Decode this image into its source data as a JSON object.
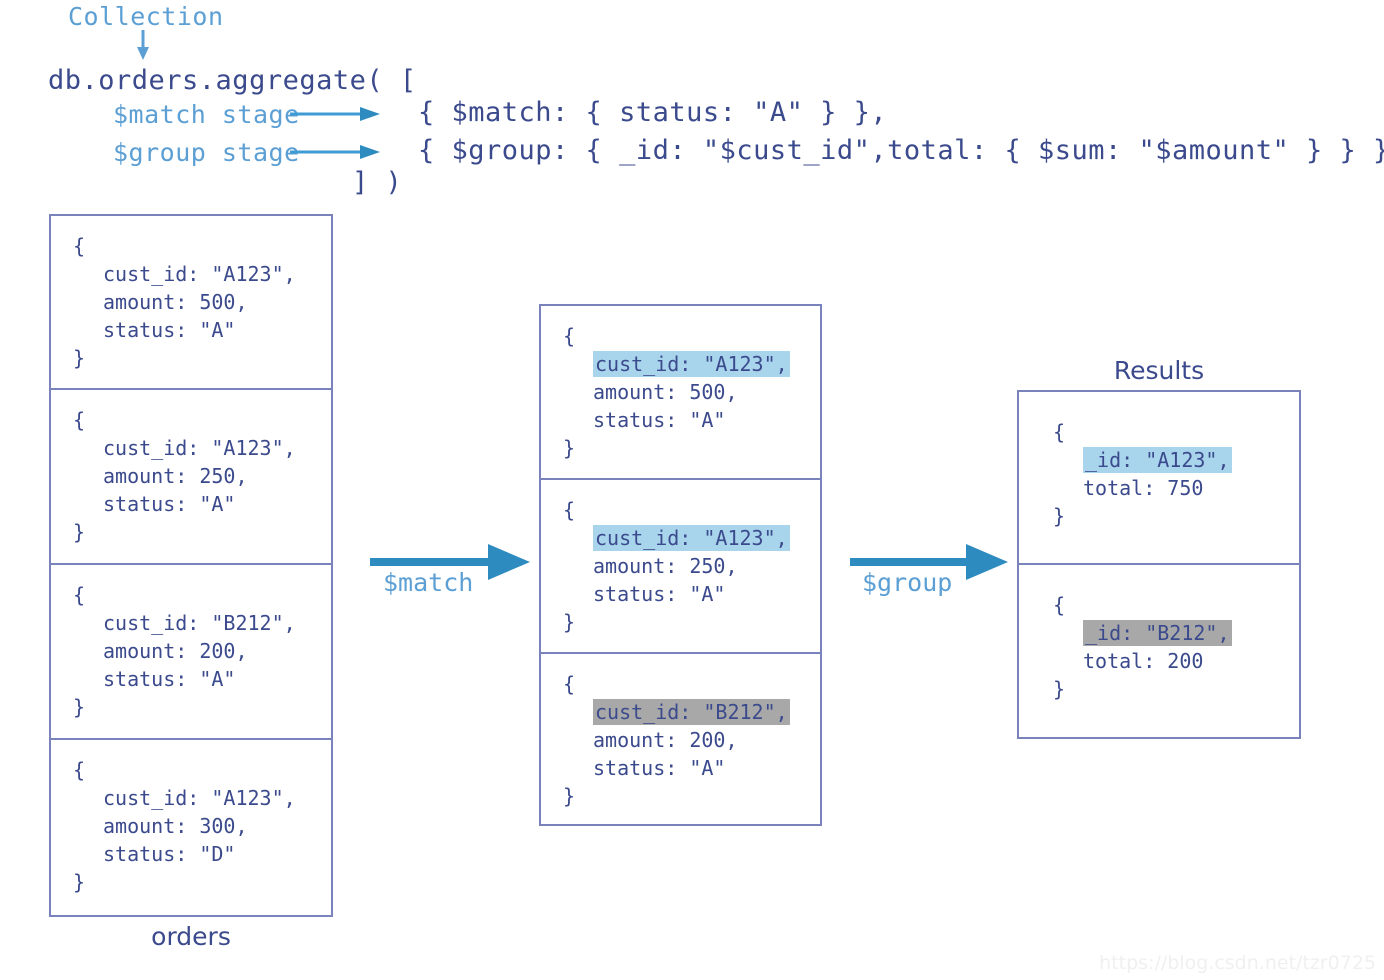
{
  "header": {
    "collection_label": "Collection",
    "aggregate_call": "db.orders.aggregate( [",
    "match_stage_label": "$match stage",
    "group_stage_label": "$group stage",
    "match_stage_code": "{ $match: { status: \"A\" } },",
    "group_stage_code": "{ $group: { _id: \"$cust_id\",total: { $sum: \"$amount\" } } }",
    "close_call": "] )"
  },
  "collection_box": {
    "caption": "orders",
    "documents": [
      {
        "open": "{",
        "lines": [
          "cust_id: \"A123\",",
          "amount: 500,",
          "status: \"A\""
        ],
        "close": "}"
      },
      {
        "open": "{",
        "lines": [
          "cust_id: \"A123\",",
          "amount: 250,",
          "status: \"A\""
        ],
        "close": "}"
      },
      {
        "open": "{",
        "lines": [
          "cust_id: \"B212\",",
          "amount: 200,",
          "status: \"A\""
        ],
        "close": "}"
      },
      {
        "open": "{",
        "lines": [
          "cust_id: \"A123\",",
          "amount: 300,",
          "status: \"D\""
        ],
        "close": "}"
      }
    ]
  },
  "match_arrow": {
    "label": "$match"
  },
  "group_arrow": {
    "label": "$group"
  },
  "matched_box": {
    "documents": [
      {
        "open": "{",
        "highlight": "cust_id: \"A123\",",
        "highlight_color": "blue",
        "lines": [
          "amount: 500,",
          "status: \"A\""
        ],
        "close": "}"
      },
      {
        "open": "{",
        "highlight": "cust_id: \"A123\",",
        "highlight_color": "blue",
        "lines": [
          "amount: 250,",
          "status: \"A\""
        ],
        "close": "}"
      },
      {
        "open": "{",
        "highlight": "cust_id: \"B212\",",
        "highlight_color": "gray",
        "lines": [
          "amount: 200,",
          "status: \"A\""
        ],
        "close": "}"
      }
    ]
  },
  "results_box": {
    "caption": "Results",
    "documents": [
      {
        "open": "{",
        "highlight": "_id: \"A123\",",
        "highlight_color": "blue",
        "lines": [
          "total: 750"
        ],
        "close": "}"
      },
      {
        "open": "{",
        "highlight": "_id: \"B212\",",
        "highlight_color": "gray",
        "lines": [
          "total: 200"
        ],
        "close": "}"
      }
    ]
  },
  "watermark": {
    "text": "https://blog.csdn.net/tzr0725"
  },
  "colors": {
    "code_text": "#3b4a8c",
    "label_blue": "#5b9fd4",
    "box_border": "#7b83bd",
    "highlight_blue": "#a8d4ec",
    "highlight_gray": "#a8a8a8",
    "arrow_blue": "#2e8bc0",
    "background": "#ffffff"
  }
}
